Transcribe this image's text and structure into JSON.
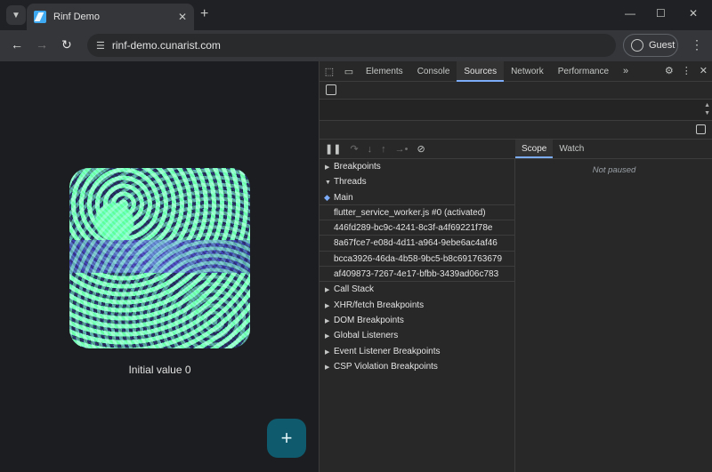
{
  "browser": {
    "tab_title": "Rinf Demo",
    "url": "rinf-demo.cunarist.com",
    "profile_label": "Guest"
  },
  "app": {
    "caption": "Initial value 0",
    "fab_label": "+"
  },
  "devtools": {
    "tabs": [
      "Elements",
      "Console",
      "Sources",
      "Network",
      "Performance"
    ],
    "active_tab": "Sources",
    "sections_top": [
      {
        "label": "Breakpoints",
        "expanded": false
      },
      {
        "label": "Threads",
        "expanded": true
      }
    ],
    "threads": [
      {
        "label": "Main",
        "current": true
      },
      {
        "label": "flutter_service_worker.js #0 (activated)",
        "current": false
      },
      {
        "label": "446fd289-bc9c-4241-8c3f-a4f69221f78e",
        "current": false
      },
      {
        "label": "8a67fce7-e08d-4d11-a964-9ebe6ac4af46",
        "current": false
      },
      {
        "label": "bcca3926-46da-4b58-9bc5-b8c691763679",
        "current": false
      },
      {
        "label": "af409873-7267-4e17-bfbb-3439ad06c783",
        "current": false
      }
    ],
    "sections_bottom": [
      {
        "label": "Call Stack"
      },
      {
        "label": "XHR/fetch Breakpoints"
      },
      {
        "label": "DOM Breakpoints"
      },
      {
        "label": "Global Listeners"
      },
      {
        "label": "Event Listener Breakpoints"
      },
      {
        "label": "CSP Violation Breakpoints"
      }
    ],
    "scope_tabs": [
      "Scope",
      "Watch"
    ],
    "active_scope_tab": "Scope",
    "status": "Not paused"
  },
  "icons": {
    "tab_search": "chevron-down-icon",
    "close": "close-icon",
    "new_tab": "plus-icon",
    "back": "arrow-left-icon",
    "forward": "arrow-right-icon",
    "reload": "reload-icon",
    "site_info": "tune-icon",
    "more": "kebab-icon"
  }
}
